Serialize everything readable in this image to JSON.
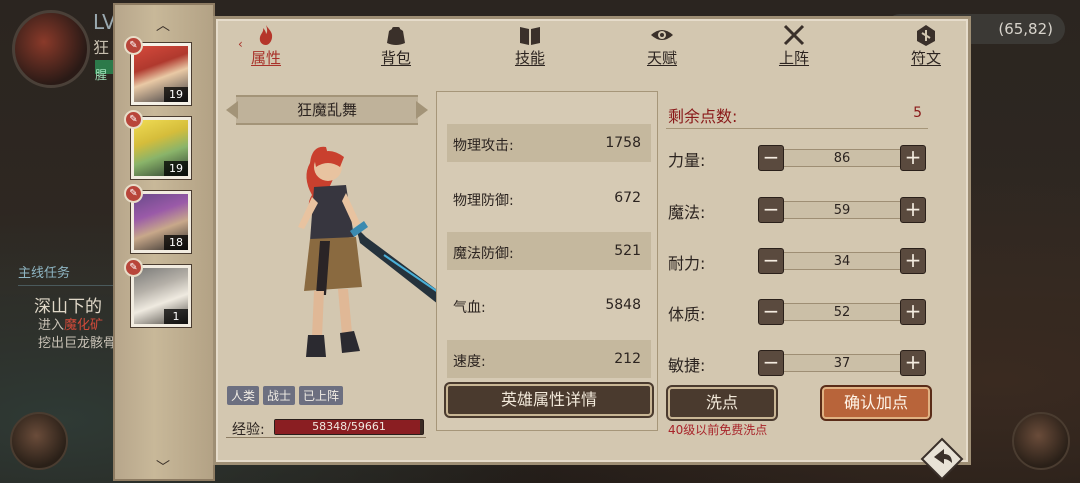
{
  "world": {
    "lv_text": "LV",
    "name_prefix": "狂",
    "status_tag": "腥",
    "quest": {
      "section_title": "主线任务",
      "name": "深山下的",
      "desc_line1_a": "进入",
      "desc_line1_b": "魔化矿",
      "desc_line2": "挖出巨龙骸骨"
    },
    "coords": "(65,82)"
  },
  "character_list": [
    {
      "level": "19",
      "badge": "✎",
      "portrait": "p1"
    },
    {
      "level": "19",
      "badge": "✎",
      "portrait": "p2"
    },
    {
      "level": "18",
      "badge": "✎",
      "portrait": "p3"
    },
    {
      "level": "1",
      "badge": "✎",
      "portrait": "p4"
    }
  ],
  "tabs": [
    {
      "label": "属性",
      "icon": "flame-icon",
      "active": true
    },
    {
      "label": "背包",
      "icon": "bag-icon",
      "active": false
    },
    {
      "label": "技能",
      "icon": "book-icon",
      "active": false
    },
    {
      "label": "天赋",
      "icon": "eye-icon",
      "active": false
    },
    {
      "label": "上阵",
      "icon": "swords-icon",
      "active": false
    },
    {
      "label": "符文",
      "icon": "rune-icon",
      "active": false
    }
  ],
  "hero": {
    "name": "狂魔乱舞",
    "tags": [
      "人类",
      "战士",
      "已上阵"
    ],
    "exp_label": "经验:",
    "exp_text": "58348/59661",
    "exp_fraction": 0.978
  },
  "stats": [
    {
      "label": "物理攻击:",
      "value": "1758"
    },
    {
      "label": "物理防御:",
      "value": "672"
    },
    {
      "label": "魔法防御:",
      "value": "521"
    },
    {
      "label": "气血:",
      "value": "5848"
    },
    {
      "label": "速度:",
      "value": "212"
    }
  ],
  "hero_detail_button": "英雄属性详情",
  "points": {
    "remain_label": "剩余点数:",
    "remain_value": "5",
    "attributes": [
      {
        "label": "力量:",
        "value": "86"
      },
      {
        "label": "魔法:",
        "value": "59"
      },
      {
        "label": "耐力:",
        "value": "34"
      },
      {
        "label": "体质:",
        "value": "52"
      },
      {
        "label": "敏捷:",
        "value": "37"
      }
    ],
    "minus_symbol": "−",
    "plus_symbol": "+"
  },
  "wash_button": "洗点",
  "wash_note": "40级以前免费洗点",
  "confirm_button": "确认加点",
  "colors": {
    "panel": "#d3c7b0",
    "active_tab": "#a8322a",
    "confirm": "#b8643a",
    "exp_fill": "#8a1e22"
  }
}
